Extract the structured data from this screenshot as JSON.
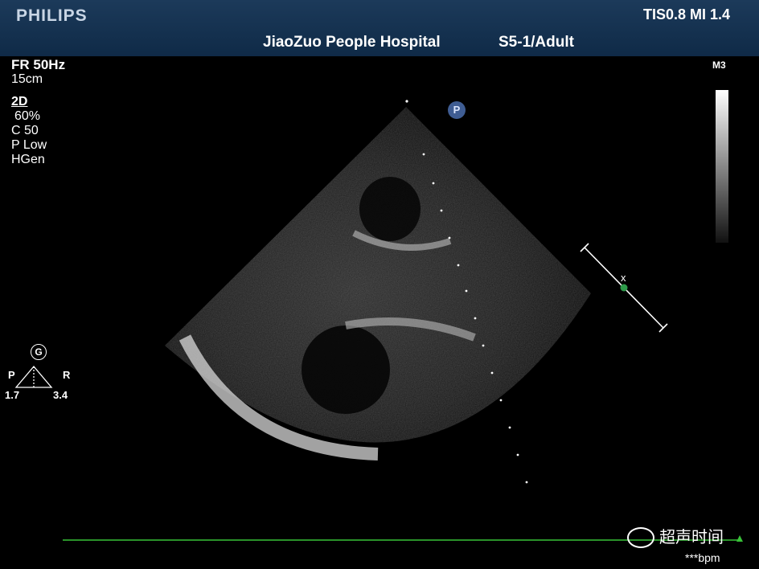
{
  "header": {
    "brand": "PHILIPS",
    "safety_index": "TIS0.8   MI 1.4",
    "institution": "JiaoZuo  People Hospital",
    "probe_preset": "S5-1/Adult"
  },
  "imaging_params": {
    "frame_rate": "FR 50Hz",
    "depth": "15cm",
    "mode": "2D",
    "gain": "60%",
    "compression": "C 50",
    "persistence": "P Low",
    "frequency": "HGen"
  },
  "grayscale_map": "M3",
  "orientation_marker": "P",
  "gain_indicator": {
    "label": "G",
    "left_label": "P",
    "right_label": "R",
    "left_value": "1.7",
    "right_value": "3.4"
  },
  "heart_rate": "***bpm",
  "watermark": "超声时间",
  "caliper_marker": "x",
  "colors": {
    "header_bg": "#0f2a47",
    "ecg_trace": "#39c239",
    "focus_dot": "#2e9b4a",
    "orientation_marker_bg": "#3f5d93"
  }
}
